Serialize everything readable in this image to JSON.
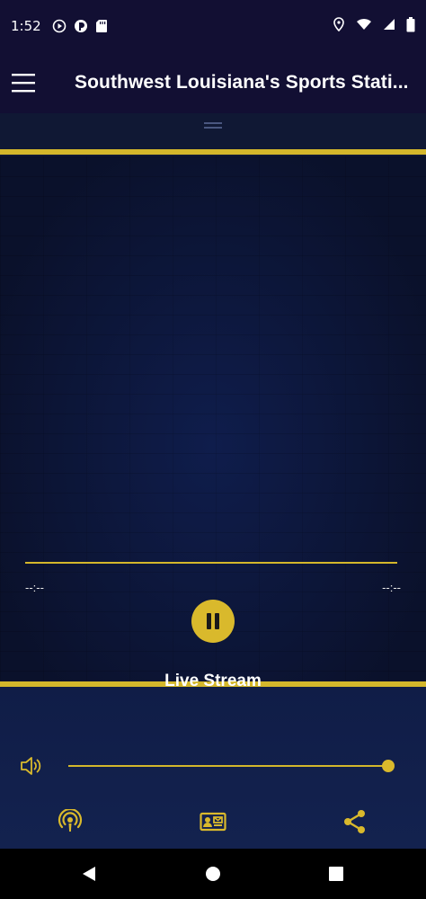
{
  "status_bar": {
    "time": "1:52",
    "left_icons": [
      "play-circle-icon",
      "pocket-casts-icon",
      "sd-card-icon"
    ],
    "right_icons": [
      "location-icon",
      "wifi-icon",
      "signal-icon",
      "battery-icon"
    ]
  },
  "app_bar": {
    "title": "Southwest Louisiana's Sports Stati..."
  },
  "player": {
    "elapsed": "--:--",
    "duration": "--:--",
    "progress": 1.0,
    "play_state": "playing",
    "stream_label": "Live Stream",
    "volume": 1.0
  },
  "actions": {
    "icons": [
      "podcast-icon",
      "contact-card-icon",
      "share-icon"
    ]
  },
  "nav_bar": {
    "icons": [
      "back-icon",
      "home-icon",
      "recents-icon"
    ]
  },
  "colors": {
    "accent": "#d9b92c",
    "bar_background": "#120f33",
    "player_background": "#0d1738"
  }
}
